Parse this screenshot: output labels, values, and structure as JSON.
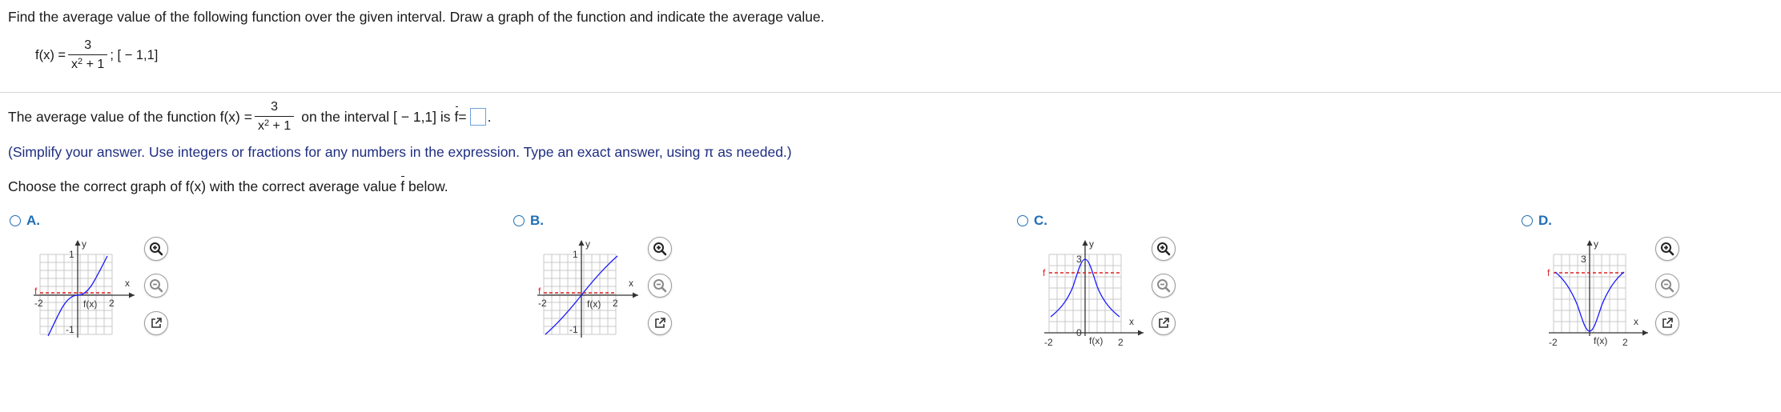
{
  "question": {
    "instruction": "Find the average value of the following function over the given interval. Draw a graph of the function and indicate the average value.",
    "fx_prefix": "f(x) =",
    "fx_numerator": "3",
    "fx_denominator_base": "x",
    "fx_denominator_exp": "2",
    "fx_denominator_rest": " + 1",
    "fx_interval": "; [ − 1,1]"
  },
  "answer": {
    "prefix": "The average value of the function f(x) =",
    "numerator": "3",
    "denominator_base": "x",
    "denominator_exp": "2",
    "denominator_rest": " + 1",
    "middle": "on the interval [ − 1,1] is",
    "fbar": "f",
    "equals": " =",
    "period": "."
  },
  "hint": "(Simplify your answer. Use integers or fractions for any numbers in the expression. Type an exact answer, using π as needed.)",
  "choose": {
    "before": "Choose the correct graph of f(x) with the correct average value",
    "fbar": "f",
    "after": " below."
  },
  "options": [
    {
      "letter": "A.",
      "axis_x": "x",
      "axis_y": "y",
      "xmin_label": "-2",
      "xmax_label": "2",
      "ytick_label": "1",
      "yneg_label": "-1",
      "fx_label": "f(x)",
      "fbar_label": "f"
    },
    {
      "letter": "B.",
      "axis_x": "x",
      "axis_y": "y",
      "xmin_label": "-2",
      "xmax_label": "2",
      "ytick_label": "1",
      "yneg_label": "-1",
      "fx_label": "f(x)",
      "fbar_label": "f"
    },
    {
      "letter": "C.",
      "axis_x": "x",
      "axis_y": "y",
      "xmin_label": "-2",
      "xmax_label": "2",
      "ytick_label": "3",
      "origin_label": "0",
      "fx_label": "f(x)",
      "fbar_label": "f"
    },
    {
      "letter": "D.",
      "axis_x": "x",
      "axis_y": "y",
      "xmin_label": "-2",
      "xmax_label": "2",
      "ytick_label": "3",
      "fx_label": "f(x)",
      "fbar_label": "f"
    }
  ],
  "icons": {
    "zoom_in": "zoom-in-icon",
    "zoom_out": "zoom-out-icon",
    "popout": "popout-icon"
  },
  "colors": {
    "curve": "#1a1aff",
    "average_line": "#e02020",
    "option_letter": "#1f6fb5",
    "hint": "#1f2d80",
    "answer_box": "#6ea0dc",
    "grid": "#c8c8c8"
  }
}
